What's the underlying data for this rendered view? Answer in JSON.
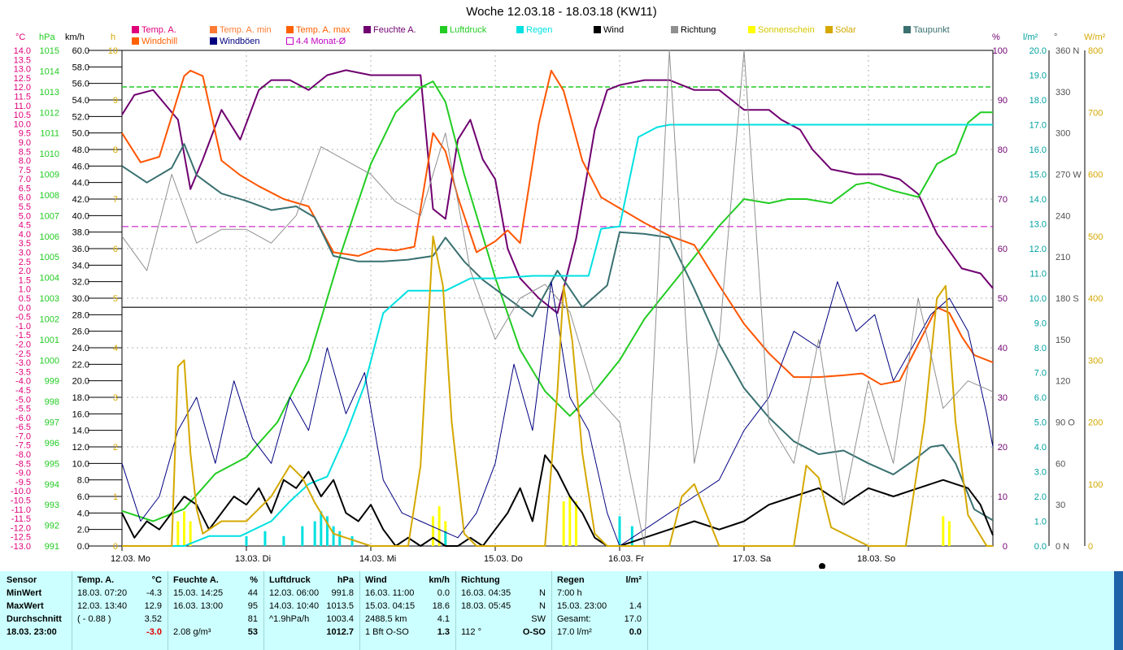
{
  "title": "Woche 12.03.18 - 18.03.18 (KW11)",
  "legend": [
    {
      "label": "Temp. A.",
      "color": "#e0007a"
    },
    {
      "label": "Windchill",
      "color": "#ff6000"
    },
    {
      "label": "Temp. A. min",
      "color": "#ff7b33"
    },
    {
      "label": "Windböen",
      "color": "#000080"
    },
    {
      "label": "Temp. A. max",
      "color": "#ff6000"
    },
    {
      "label": "4.4 Monat-Ø",
      "color": "#c000c0"
    },
    {
      "label": "Feuchte A.",
      "color": "#700070"
    },
    {
      "label": "Luftdruck",
      "color": "#22cc22"
    },
    {
      "label": "Regen",
      "color": "#00e0e0"
    },
    {
      "label": "Wind",
      "color": "#000000"
    },
    {
      "label": "Richtung",
      "color": "#909090"
    },
    {
      "label": "Sonnenschein",
      "color": "#ffff00"
    },
    {
      "label": "Solar",
      "color": "#d4a800"
    },
    {
      "label": "Taupunkt",
      "color": "#3a7070"
    }
  ],
  "axis_units": {
    "temp": "°C",
    "pressure": "hPa",
    "wind": "km/h",
    "sun": "h",
    "humidity": "%",
    "rain": "l/m²",
    "direction": "°",
    "solar": "W/m²"
  },
  "days": [
    "12.03. Mo",
    "13.03. Di",
    "14.03. Mi",
    "15.03. Do",
    "16.03. Fr",
    "17.03. Sa",
    "18.03. So"
  ],
  "chart_data": {
    "type": "line",
    "title": "Woche 12.03.18 - 18.03.18 (KW11)",
    "x_range_days": [
      0,
      7
    ],
    "axes": {
      "temp": {
        "label": "°C",
        "range": [
          -13.0,
          14.0
        ],
        "step": 0.5
      },
      "pressure": {
        "label": "hPa",
        "range": [
          991,
          1015
        ],
        "step": 1
      },
      "wind": {
        "label": "km/h",
        "range": [
          0,
          60
        ],
        "step": 2
      },
      "sun": {
        "label": "h",
        "range": [
          0,
          10
        ],
        "step": 1
      },
      "humidity": {
        "label": "%",
        "range": [
          0,
          100
        ],
        "step": 10
      },
      "rain": {
        "label": "l/m²",
        "range": [
          0,
          20
        ],
        "step": 1
      },
      "direction": {
        "label": "°",
        "ticks": [
          "0 N",
          "30",
          "60",
          "90 O",
          "120",
          "150",
          "180 S",
          "210",
          "240",
          "270 W",
          "300",
          "330",
          "360 N"
        ]
      },
      "solar": {
        "label": "W/m²",
        "range": [
          0,
          800
        ],
        "step": 100
      }
    },
    "reference_lines": [
      {
        "name": "4.4 Monat-Ø",
        "axis": "temp",
        "value": 4.4
      },
      {
        "name": "0 °C",
        "axis": "temp",
        "value": 0
      }
    ],
    "series": [
      {
        "name": "Feuchte A.",
        "axis": "humidity",
        "color": "#700070",
        "x": [
          0,
          0.1,
          0.25,
          0.45,
          0.55,
          0.65,
          0.8,
          0.95,
          1.1,
          1.2,
          1.35,
          1.5,
          1.65,
          1.8,
          2.0,
          2.2,
          2.4,
          2.5,
          2.6,
          2.7,
          2.8,
          2.9,
          3.0,
          3.1,
          3.2,
          3.35,
          3.5,
          3.65,
          3.8,
          3.9,
          4.0,
          4.2,
          4.4,
          4.6,
          4.8,
          5.0,
          5.2,
          5.3,
          5.45,
          5.55,
          5.7,
          5.9,
          6.1,
          6.25,
          6.4,
          6.55,
          6.75,
          6.9,
          7.0
        ],
        "y": [
          87,
          91,
          92,
          86,
          72,
          78,
          88,
          82,
          92,
          94,
          94,
          92,
          95,
          96,
          95,
          95,
          95,
          68,
          66,
          82,
          86,
          78,
          74,
          60,
          54,
          50,
          47,
          62,
          84,
          92,
          93,
          94,
          94,
          92,
          92,
          88,
          88,
          86,
          84,
          80,
          76,
          75,
          75,
          74,
          71,
          63,
          56,
          55,
          52
        ]
      },
      {
        "name": "Luftdruck",
        "axis": "pressure",
        "color": "#22cc22",
        "x": [
          0,
          0.25,
          0.5,
          0.75,
          1.0,
          1.25,
          1.5,
          1.75,
          2.0,
          2.2,
          2.4,
          2.5,
          2.6,
          2.75,
          3.0,
          3.2,
          3.4,
          3.6,
          3.8,
          4.0,
          4.2,
          4.4,
          4.6,
          4.8,
          5.0,
          5.2,
          5.35,
          5.5,
          5.7,
          5.9,
          6.0,
          6.2,
          6.4,
          6.55,
          6.7,
          6.8,
          6.9,
          7.0
        ],
        "y": [
          992.7,
          992.2,
          992.8,
          994.5,
          995.3,
          997,
          1000,
          1005,
          1009.5,
          1012,
          1013.2,
          1013.5,
          1012.5,
          1009,
          1004,
          1000.5,
          998.5,
          997.3,
          998.5,
          1000,
          1002,
          1003.5,
          1005,
          1006.5,
          1007.8,
          1007.6,
          1007.8,
          1007.8,
          1007.6,
          1008.5,
          1008.6,
          1008.2,
          1007.9,
          1009.5,
          1010,
          1011.5,
          1012,
          1012
        ]
      },
      {
        "name": "Temp. A.",
        "axis": "temp",
        "color": "#ff5500",
        "x": [
          0,
          0.15,
          0.3,
          0.5,
          0.55,
          0.65,
          0.8,
          0.95,
          1.1,
          1.3,
          1.5,
          1.7,
          1.9,
          2.05,
          2.2,
          2.35,
          2.5,
          2.6,
          2.7,
          2.85,
          3.0,
          3.1,
          3.2,
          3.35,
          3.45,
          3.55,
          3.7,
          3.85,
          4.0,
          4.2,
          4.4,
          4.6,
          4.8,
          5.0,
          5.2,
          5.4,
          5.6,
          5.8,
          5.95,
          6.1,
          6.25,
          6.4,
          6.55,
          6.65,
          6.75,
          6.85,
          7.0
        ],
        "y": [
          9.5,
          7.9,
          8.2,
          12.6,
          12.9,
          12.6,
          8,
          7.2,
          6.6,
          5.9,
          5.5,
          3,
          2.8,
          3.2,
          3.1,
          3.3,
          9.5,
          8.5,
          6,
          3,
          3.6,
          4.2,
          3.5,
          10,
          12.9,
          11.8,
          8,
          6,
          5.4,
          4.6,
          3.9,
          3.4,
          1.2,
          -0.9,
          -2.5,
          -3.8,
          -3.8,
          -3.7,
          -3.6,
          -4.2,
          -4,
          -2,
          0,
          -0.3,
          -1.6,
          -2.6,
          -3.0
        ]
      },
      {
        "name": "Taupunkt",
        "axis": "temp",
        "color": "#3a7070",
        "x": [
          0,
          0.2,
          0.4,
          0.5,
          0.6,
          0.8,
          1.0,
          1.2,
          1.4,
          1.55,
          1.7,
          1.9,
          2.1,
          2.3,
          2.5,
          2.6,
          2.75,
          2.9,
          3.1,
          3.3,
          3.5,
          3.7,
          3.9,
          4.0,
          4.2,
          4.4,
          4.6,
          4.8,
          5.0,
          5.2,
          5.4,
          5.6,
          5.8,
          6.0,
          6.2,
          6.35,
          6.5,
          6.6,
          6.7,
          6.85,
          7.0
        ],
        "y": [
          7.7,
          6.8,
          7.6,
          8.9,
          7.2,
          6.2,
          5.8,
          5.3,
          5.5,
          4.9,
          2.8,
          2.5,
          2.5,
          2.6,
          2.8,
          3.8,
          2.5,
          1.5,
          0.5,
          -0.5,
          2.0,
          0,
          1.2,
          4.1,
          4.0,
          3.8,
          1,
          -2,
          -4.4,
          -6,
          -7.3,
          -8,
          -7.8,
          -8.5,
          -9.1,
          -8.4,
          -7.6,
          -7.5,
          -8.5,
          -11,
          -11.6
        ]
      },
      {
        "name": "Regen",
        "axis": "rain",
        "color": "#00e0e0",
        "x": [
          0,
          0.5,
          0.7,
          0.95,
          1.2,
          1.35,
          1.5,
          1.65,
          1.8,
          1.95,
          2.1,
          2.3,
          2.6,
          2.8,
          3.0,
          3.3,
          3.55,
          3.65,
          3.75,
          3.85,
          4.0,
          4.15,
          4.3,
          4.4,
          7.0
        ],
        "y": [
          0,
          0,
          0.4,
          0.4,
          1.0,
          1.8,
          2.5,
          2.8,
          4.5,
          6.5,
          9.4,
          10.3,
          10.3,
          10.8,
          10.8,
          10.9,
          10.9,
          10.9,
          10.9,
          12.8,
          12.9,
          16.5,
          16.9,
          17.0,
          17.0
        ]
      },
      {
        "name": "Wind",
        "axis": "wind",
        "color": "#000000",
        "x": [
          0,
          0.1,
          0.2,
          0.3,
          0.4,
          0.5,
          0.6,
          0.7,
          0.8,
          0.9,
          1.0,
          1.1,
          1.2,
          1.3,
          1.4,
          1.5,
          1.6,
          1.7,
          1.8,
          1.9,
          2.0,
          2.1,
          2.2,
          2.3,
          2.4,
          2.5,
          2.6,
          2.7,
          2.8,
          2.9,
          3.0,
          3.1,
          3.2,
          3.3,
          3.4,
          3.5,
          3.6,
          3.7,
          3.8,
          3.9,
          4.0,
          4.2,
          4.4,
          4.6,
          4.8,
          5.0,
          5.2,
          5.4,
          5.6,
          5.8,
          6.0,
          6.2,
          6.4,
          6.6,
          6.8,
          6.9,
          7.0
        ],
        "y": [
          4,
          1,
          3,
          2,
          4,
          6,
          5,
          2,
          4,
          6,
          5,
          7,
          4,
          8,
          7,
          9,
          6,
          8,
          4,
          3,
          5,
          2,
          0,
          1,
          0,
          1,
          0,
          0,
          1,
          0,
          2,
          4,
          7,
          3,
          11,
          9,
          6,
          4,
          1,
          0,
          0,
          1,
          2,
          3,
          2,
          3,
          5,
          6,
          7,
          5,
          7,
          6,
          7,
          8,
          7,
          5,
          1.3
        ]
      },
      {
        "name": "Windböen",
        "axis": "wind",
        "color": "#000080",
        "x": [
          0,
          0.15,
          0.3,
          0.45,
          0.6,
          0.75,
          0.9,
          1.05,
          1.2,
          1.35,
          1.5,
          1.65,
          1.8,
          1.95,
          2.1,
          2.25,
          2.4,
          2.55,
          2.7,
          2.85,
          3.0,
          3.15,
          3.3,
          3.45,
          3.6,
          3.75,
          3.9,
          4.0,
          4.2,
          4.4,
          4.6,
          4.8,
          5.0,
          5.2,
          5.4,
          5.6,
          5.75,
          5.9,
          6.05,
          6.2,
          6.35,
          6.5,
          6.65,
          6.8,
          6.95,
          7.0
        ],
        "y": [
          10,
          3,
          6,
          14,
          18,
          10,
          20,
          13,
          10,
          18,
          14,
          24,
          16,
          21,
          8,
          4,
          3,
          2,
          1,
          4,
          10,
          22,
          14,
          32,
          18,
          14,
          4,
          0,
          2,
          4,
          6,
          8,
          14,
          18,
          26,
          24,
          32,
          26,
          28,
          20,
          24,
          28,
          30,
          26,
          16,
          12
        ]
      },
      {
        "name": "Solar",
        "axis": "solar",
        "color": "#d4a800",
        "x": [
          0,
          0.4,
          0.45,
          0.5,
          0.55,
          0.6,
          0.65,
          0.8,
          1.0,
          1.2,
          1.35,
          1.45,
          1.55,
          1.7,
          2.0,
          2.3,
          2.4,
          2.5,
          2.58,
          2.65,
          2.75,
          2.85,
          3.0,
          3.4,
          3.5,
          3.55,
          3.62,
          3.7,
          3.8,
          3.9,
          4.0,
          4.4,
          4.5,
          4.6,
          4.7,
          4.8,
          5.0,
          5.4,
          5.5,
          5.6,
          5.7,
          6.0,
          6.3,
          6.45,
          6.55,
          6.62,
          6.7,
          6.8,
          6.95,
          7.0
        ],
        "y": [
          0,
          0,
          290,
          300,
          150,
          60,
          20,
          40,
          40,
          80,
          130,
          110,
          70,
          20,
          0,
          0,
          130,
          500,
          420,
          200,
          20,
          0,
          0,
          0,
          250,
          420,
          330,
          150,
          20,
          0,
          0,
          0,
          80,
          100,
          50,
          0,
          0,
          0,
          130,
          110,
          30,
          0,
          0,
          200,
          400,
          420,
          200,
          50,
          0,
          0
        ]
      },
      {
        "name": "Richtung",
        "axis": "direction",
        "color": "#909090",
        "x": [
          0,
          0.2,
          0.4,
          0.6,
          0.8,
          1.0,
          1.2,
          1.4,
          1.6,
          1.8,
          2.0,
          2.2,
          2.4,
          2.6,
          2.8,
          3.0,
          3.2,
          3.4,
          3.6,
          3.8,
          4.0,
          4.2,
          4.4,
          4.6,
          4.8,
          5.0,
          5.2,
          5.4,
          5.6,
          5.8,
          6.0,
          6.2,
          6.4,
          6.6,
          6.8,
          7.0
        ],
        "y": [
          225,
          200,
          270,
          220,
          230,
          230,
          220,
          240,
          290,
          280,
          270,
          250,
          240,
          300,
          200,
          150,
          180,
          190,
          170,
          110,
          90,
          0,
          360,
          60,
          150,
          360,
          90,
          60,
          150,
          30,
          120,
          60,
          180,
          100,
          120,
          112
        ]
      }
    ],
    "bars": [
      {
        "name": "Sonnenschein",
        "axis": "sun",
        "color": "#ffff00",
        "x": [
          0.45,
          0.5,
          0.55,
          2.5,
          2.55,
          2.6,
          3.55,
          3.6,
          3.65,
          6.6,
          6.65
        ],
        "y": [
          0.5,
          0.7,
          0.5,
          0.6,
          0.8,
          0.5,
          0.9,
          1.0,
          0.9,
          0.6,
          0.5
        ]
      },
      {
        "name": "Regen",
        "axis": "sun",
        "color": "#00e0e0",
        "x": [
          1.0,
          1.15,
          1.3,
          1.45,
          1.55,
          1.6,
          1.65,
          1.7,
          1.75,
          1.85,
          2.6,
          4.0,
          4.1
        ],
        "y": [
          0.2,
          0.3,
          0.2,
          0.4,
          0.5,
          0.7,
          0.6,
          0.4,
          0.3,
          0.2,
          0.3,
          0.6,
          0.4
        ]
      }
    ]
  },
  "stats": {
    "headers": {
      "sensor": "Sensor",
      "temp": "Temp. A.",
      "temp_unit": "°C",
      "hum": "Feuchte A.",
      "hum_unit": "%",
      "press": "Luftdruck",
      "press_unit": "hPa",
      "wind": "Wind",
      "wind_unit": "km/h",
      "dir": "Richtung",
      "rain": "Regen",
      "rain_unit": "l/m²"
    },
    "rows": [
      "MinWert",
      "MaxWert",
      "Durchschnitt",
      "18.03. 23:00"
    ],
    "temp": [
      [
        "18.03.  07:20",
        "-4.3"
      ],
      [
        "12.03.  13:40",
        "12.9"
      ],
      [
        "( - 0.88 )",
        "3.52"
      ],
      [
        "",
        "-3.0"
      ]
    ],
    "hum": [
      [
        "15.03.  14:25",
        "44"
      ],
      [
        "16.03.  13:00",
        "95"
      ],
      [
        "",
        "81"
      ],
      [
        "2.08 g/m³",
        "53"
      ]
    ],
    "press": [
      [
        "12.03.  06:00",
        "991.8"
      ],
      [
        "14.03.  10:40",
        "1013.5"
      ],
      [
        "^1.9hPa/h",
        "1003.4"
      ],
      [
        "",
        "1012.7"
      ]
    ],
    "wind": [
      [
        "16.03.  11:00",
        "0.0"
      ],
      [
        "15.03.  04:15",
        "18.6"
      ],
      [
        "2488.5 km",
        "4.1"
      ],
      [
        "1 Bft O-SO",
        "1.3"
      ]
    ],
    "dir": [
      [
        "16.03.  04:35",
        "N"
      ],
      [
        "18.03.  05:45",
        "N"
      ],
      [
        "",
        "SW"
      ],
      [
        "112 °",
        "O-SO"
      ]
    ],
    "rain": [
      [
        "7:00 h",
        ""
      ],
      [
        "15.03.  23:00",
        "1.4"
      ],
      [
        "Gesamt:",
        "17.0"
      ],
      [
        "17.0 l/m²",
        "0.0"
      ]
    ]
  }
}
